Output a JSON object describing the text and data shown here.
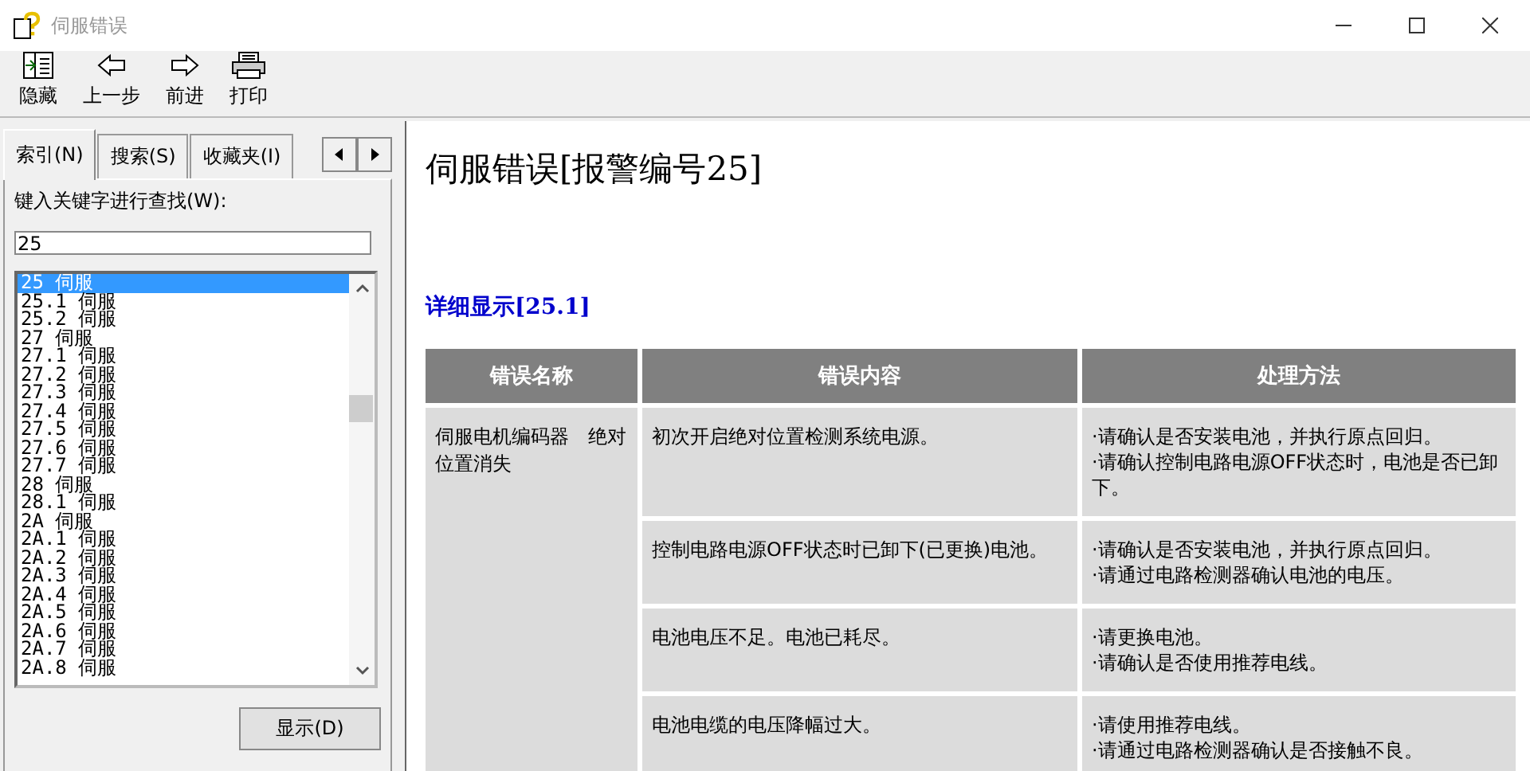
{
  "window": {
    "title": "伺服错误"
  },
  "toolbar": [
    {
      "kind": "hide",
      "label": "隐藏"
    },
    {
      "kind": "back",
      "label": "上一步"
    },
    {
      "kind": "forward",
      "label": "前进"
    },
    {
      "kind": "print",
      "label": "打印"
    }
  ],
  "tabs": [
    {
      "label": "索引(N)",
      "selected": true
    },
    {
      "label": "搜索(S)",
      "selected": false
    },
    {
      "label": "收藏夹(I)",
      "selected": false
    }
  ],
  "keyword": {
    "label": "键入关键字进行查找(W):",
    "value": "25"
  },
  "index_list": [
    {
      "text": "25 伺服",
      "selected": true
    },
    {
      "text": "25.1 伺服",
      "selected": false
    },
    {
      "text": "25.2 伺服",
      "selected": false
    },
    {
      "text": "27 伺服",
      "selected": false
    },
    {
      "text": "27.1 伺服",
      "selected": false
    },
    {
      "text": "27.2 伺服",
      "selected": false
    },
    {
      "text": "27.3 伺服",
      "selected": false
    },
    {
      "text": "27.4 伺服",
      "selected": false
    },
    {
      "text": "27.5 伺服",
      "selected": false
    },
    {
      "text": "27.6 伺服",
      "selected": false
    },
    {
      "text": "27.7 伺服",
      "selected": false
    },
    {
      "text": "28 伺服",
      "selected": false
    },
    {
      "text": "28.1 伺服",
      "selected": false
    },
    {
      "text": "2A 伺服",
      "selected": false
    },
    {
      "text": "2A.1 伺服",
      "selected": false
    },
    {
      "text": "2A.2 伺服",
      "selected": false
    },
    {
      "text": "2A.3 伺服",
      "selected": false
    },
    {
      "text": "2A.4 伺服",
      "selected": false
    },
    {
      "text": "2A.5 伺服",
      "selected": false
    },
    {
      "text": "2A.6 伺服",
      "selected": false
    },
    {
      "text": "2A.7 伺服",
      "selected": false
    },
    {
      "text": "2A.8 伺服",
      "selected": false
    }
  ],
  "display_button": "显示(D)",
  "content": {
    "title": "伺服错误[报警编号25]",
    "subtitle": "详细显示[25.1]",
    "table": {
      "columns": [
        "错误名称",
        "错误内容",
        "处理方法"
      ],
      "name": "伺服电机编码器　绝对位置消失",
      "rows": [
        {
          "content": "初次开启绝对位置检测系统电源。",
          "actions": [
            "·请确认是否安装电池，并执行原点回归。",
            "·请确认控制电路电源OFF状态时，电池是否已卸下。"
          ]
        },
        {
          "content": "控制电路电源OFF状态时已卸下(已更换)电池。",
          "actions": [
            "·请确认是否安装电池，并执行原点回归。",
            "·请通过电路检测器确认电池的电压。"
          ]
        },
        {
          "content": "电池电压不足。电池已耗尽。",
          "actions": [
            "·请更换电池。",
            "·请确认是否使用推荐电线。"
          ]
        },
        {
          "content": "电池电缆的电压降幅过大。",
          "actions": [
            "·请使用推荐电线。",
            "·请通过电路检测器确认是否接触不良。"
          ]
        }
      ]
    }
  }
}
